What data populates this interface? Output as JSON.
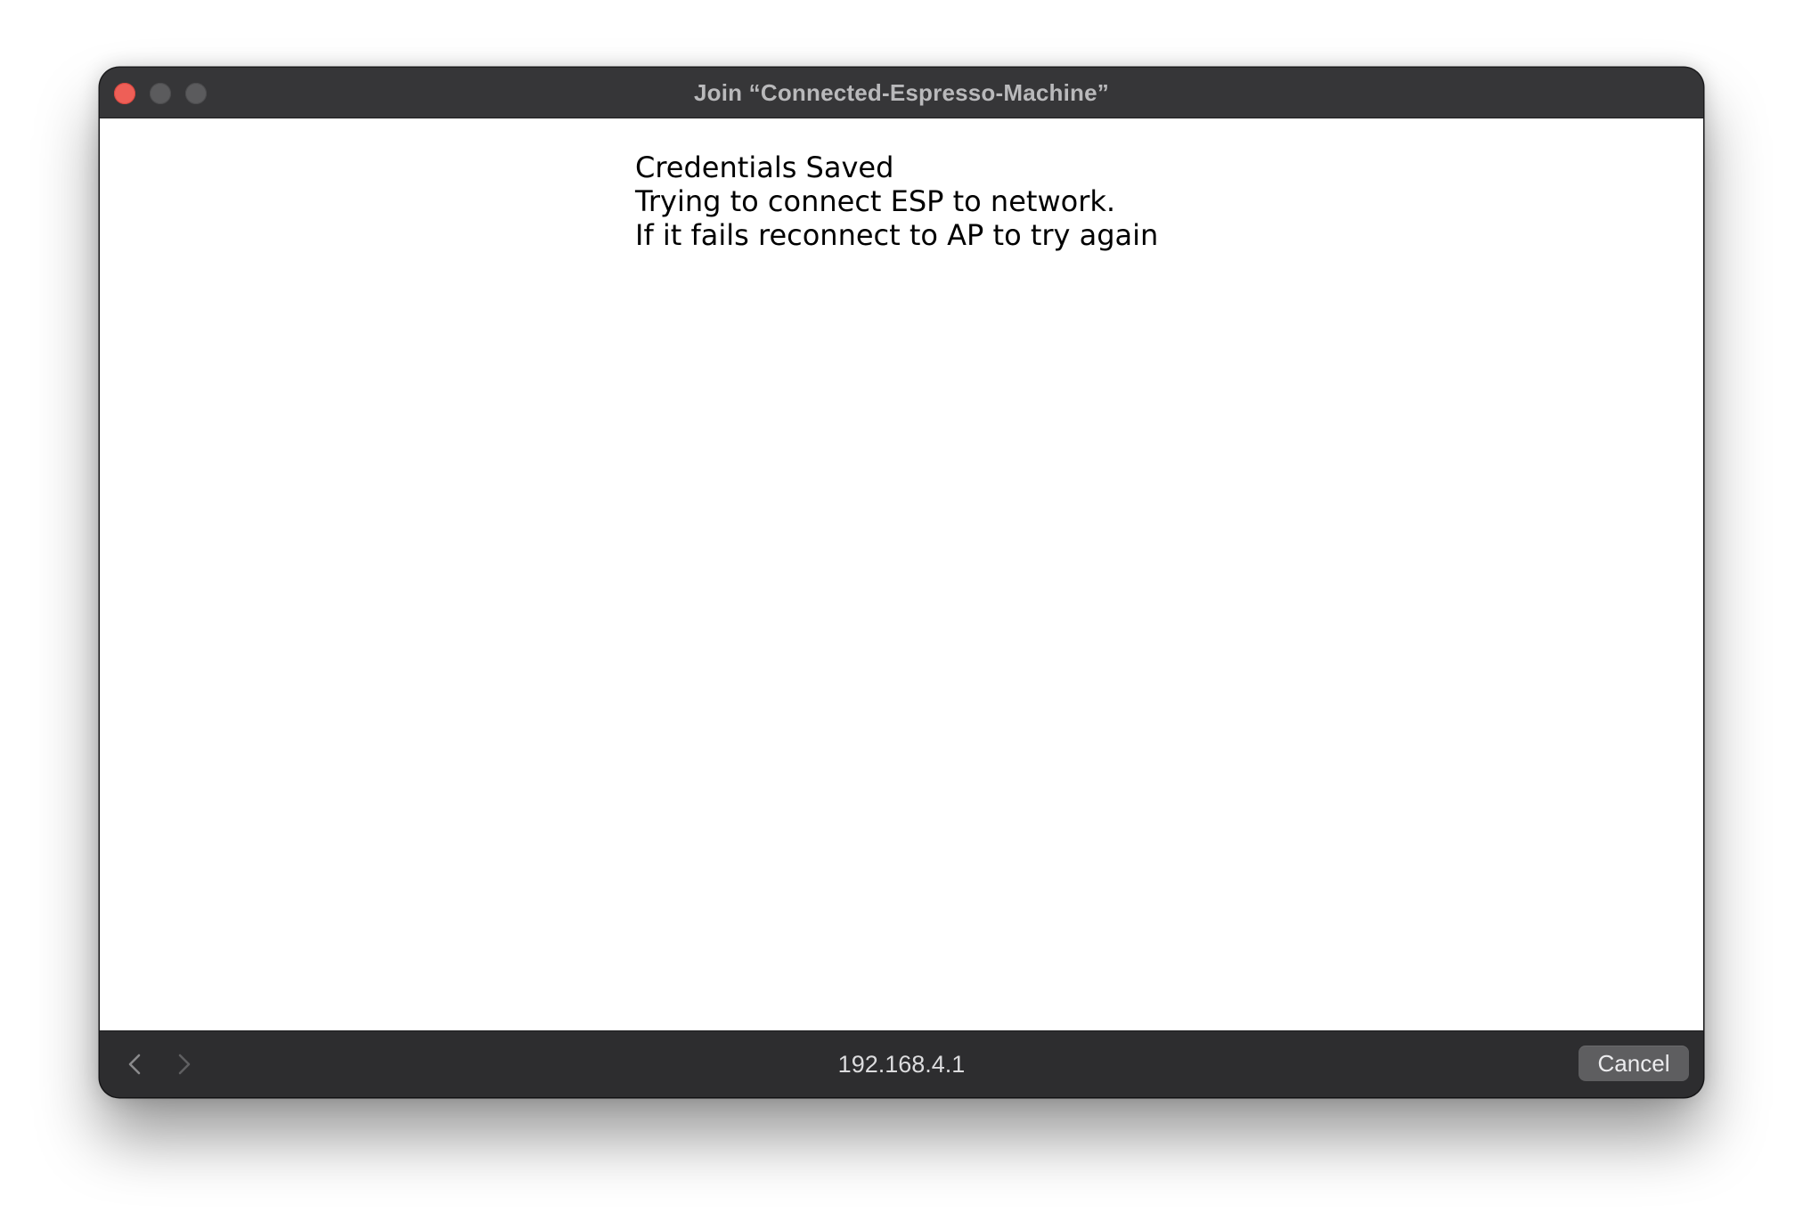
{
  "window": {
    "title": "Join “Connected-Espresso-Machine”"
  },
  "content": {
    "lines": [
      "Credentials Saved",
      "Trying to connect ESP to network.",
      "If it fails reconnect to AP to try again"
    ]
  },
  "bottom_bar": {
    "address": "192.168.4.1",
    "cancel_label": "Cancel",
    "back_icon": "chevron-left-icon",
    "forward_icon": "chevron-right-icon"
  },
  "colors": {
    "close_button": "#ee5f57",
    "titlebar": "#363638",
    "bottombar": "#2d2d2f",
    "cancel_button": "#5e5e60"
  }
}
